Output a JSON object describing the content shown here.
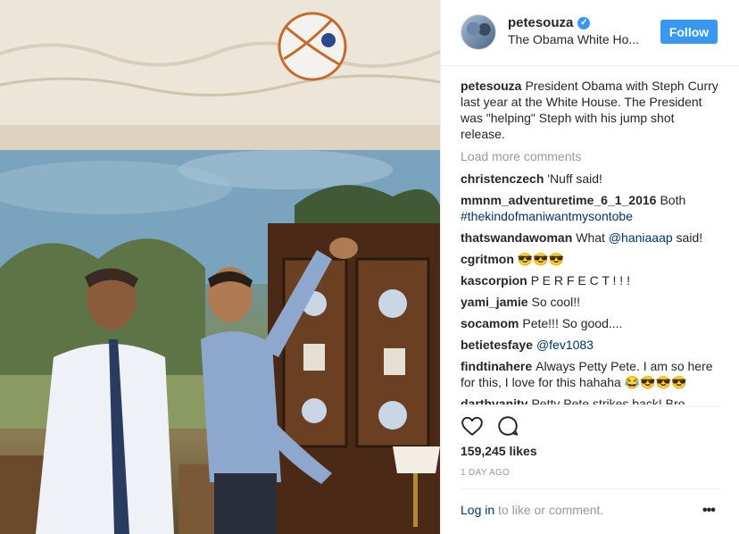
{
  "post": {
    "username": "petesouza",
    "location": "The Obama White Ho...",
    "follow_label": "Follow",
    "caption_user": "petesouza",
    "caption_text": "President Obama with Steph Curry last year at the White House. The President was \"helping\" Steph with his jump shot release.",
    "load_more": "Load more comments",
    "likes": "159,245 likes",
    "timestamp": "1 DAY AGO",
    "login_link": "Log in",
    "login_suffix": " to like or comment.",
    "more_label": "•••"
  },
  "comments": [
    {
      "user": "christenczech",
      "text": "'Nuff said!"
    },
    {
      "user": "mmnm_adventuretime_6_1_2016",
      "text": "Both",
      "link": "#thekindofmaniwantmysontobe"
    },
    {
      "user": "thatswandawoman",
      "text": "What",
      "link": "@haniaaap",
      "after": "said!"
    },
    {
      "user": "cgritmon",
      "text": "😎😎😎"
    },
    {
      "user": "kascorpion",
      "text": "P E R F E C T ! ! !"
    },
    {
      "user": "yami_jamie",
      "text": "So cool!!"
    },
    {
      "user": "socamom",
      "text": "Pete!!! So good...."
    },
    {
      "user": "betietesfaye",
      "text": "",
      "link": "@fev1083"
    },
    {
      "user": "findtinahere",
      "text": "Always Petty Pete. I am so here for this, I love for this hahaha 😂😎😎😎"
    },
    {
      "user": "darthvanity",
      "text": "Petty Pete strikes back! Bro"
    }
  ],
  "icons": {
    "verified": "verified-badge-icon",
    "like": "heart-icon",
    "comment": "comment-bubble-icon",
    "more": "more-dots-icon"
  },
  "colors": {
    "accent": "#3897f0",
    "link": "#003569",
    "muted": "#999999"
  }
}
